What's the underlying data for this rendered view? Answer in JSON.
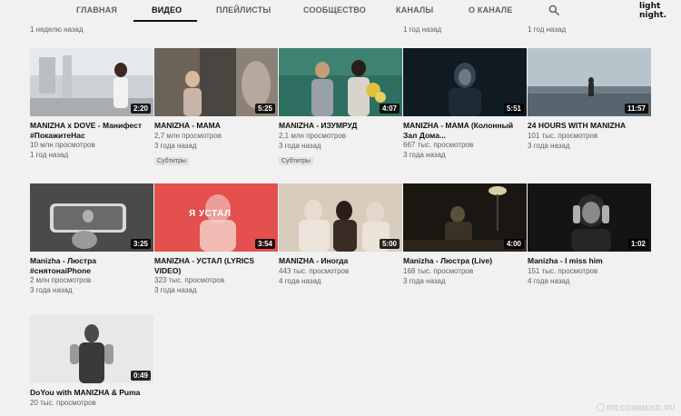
{
  "nav": {
    "tabs": [
      "ГЛАВНАЯ",
      "ВИДЕО",
      "ПЛЕЙЛИСТЫ",
      "СООБЩЕСТВО",
      "КАНАЛЫ",
      "О КАНАЛЕ"
    ],
    "active": "ВИДЕО",
    "search_icon": "search-icon"
  },
  "user": {
    "name": "light night."
  },
  "prev_row_meta": [
    "1 неделю назад",
    "1 год назад",
    "1 год назад"
  ],
  "rows": [
    [
      {
        "title": "MANIZHA x DOVE - Манифест #ПокажитеНас",
        "views": "10 млн просмотров",
        "age": "1 год назад",
        "duration": "2:20",
        "badge": ""
      },
      {
        "title": "MANIZHA - MAMA",
        "views": "2,7 млн просмотров",
        "age": "3 года назад",
        "duration": "5:25",
        "badge": "Субтитры"
      },
      {
        "title": "MANIZHA - ИЗУМРУД",
        "views": "2,1 млн просмотров",
        "age": "3 года назад",
        "duration": "4:07",
        "badge": "Субтитры"
      },
      {
        "title": "MANIZHA - MAMA (Колонный Зал Дома...",
        "views": "667 тыс. просмотров",
        "age": "3 года назад",
        "duration": "5:51",
        "badge": ""
      },
      {
        "title": "24 HOURS WITH MANIZHA",
        "views": "101 тыс. просмотров",
        "age": "3 года назад",
        "duration": "11:57",
        "badge": ""
      }
    ],
    [
      {
        "title": "Manizha - Люстра #снятонаiPhone",
        "views": "2 млн просмотров",
        "age": "3 года назад",
        "duration": "3:25",
        "badge": ""
      },
      {
        "title": "MANIZHA - УСТАЛ (LYRICS VIDEO)",
        "views": "323 тыс. просмотров",
        "age": "3 года назад",
        "duration": "3:54",
        "badge": "",
        "overlay": "Я УСТАЛ"
      },
      {
        "title": "MANIZHA - Иногда",
        "views": "443 тыс. просмотров",
        "age": "4 года назад",
        "duration": "5:00",
        "badge": ""
      },
      {
        "title": "Manizha - Люстра (Live)",
        "views": "168 тыс. просмотров",
        "age": "3 года назад",
        "duration": "4:00",
        "badge": ""
      },
      {
        "title": "Manizha - I miss him",
        "views": "151 тыс. просмотров",
        "age": "4 года назад",
        "duration": "1:02",
        "badge": ""
      }
    ],
    [
      {
        "title": "DoYou with MANIZHA & Puma",
        "views": "20 тыс. просмотров",
        "age": "",
        "duration": "0:49",
        "badge": ""
      }
    ]
  ],
  "watermark": "IRECOMMEND.RU"
}
